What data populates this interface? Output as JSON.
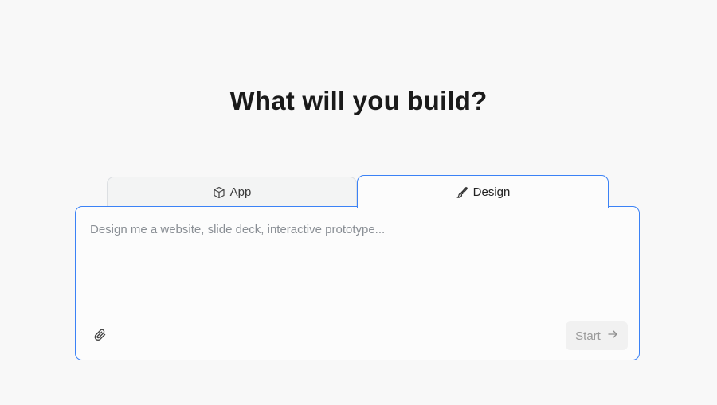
{
  "heading": "What will you build?",
  "tabs": [
    {
      "label": "App",
      "icon": "cube-icon",
      "active": false
    },
    {
      "label": "Design",
      "icon": "paintbrush-icon",
      "active": true
    }
  ],
  "prompt": {
    "value": "",
    "placeholder": "Design me a website, slide deck, interactive prototype..."
  },
  "actions": {
    "attach_icon": "paperclip-icon",
    "start_label": "Start",
    "start_icon": "arrow-right-icon"
  },
  "colors": {
    "accent": "#3b82f6",
    "background": "#f8f8f8",
    "heading_text": "#1a1a1a",
    "placeholder_text": "#8a8f95",
    "start_disabled_text": "#9a9a9a"
  }
}
